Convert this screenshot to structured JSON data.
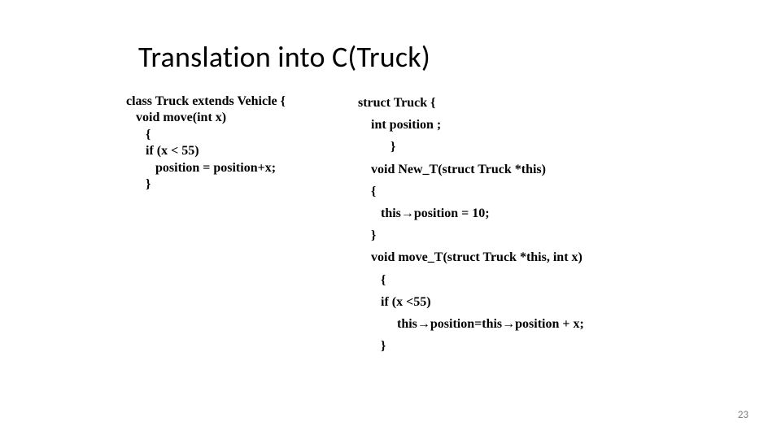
{
  "title": "Translation into C(Truck)",
  "page_number": "23",
  "left": {
    "l1": "class Truck extends Vehicle {",
    "l2": "void move(int x)",
    "l3": "{",
    "l4": "if (x < 55)",
    "l5": "position = position+x;",
    "l6": "}"
  },
  "right": {
    "r1": "struct  Truck {",
    "r2": "int position ;",
    "r3": "}",
    "r4": "void New_T(struct Truck *this)",
    "r5": "{",
    "r6": "this→position = 10;",
    "r7": "}",
    "r8": "void move_T(struct Truck *this, int x)",
    "r9": "{",
    "r10": "if (x <55)",
    "r11": "this→position=this→position + x;",
    "r12": "}"
  }
}
